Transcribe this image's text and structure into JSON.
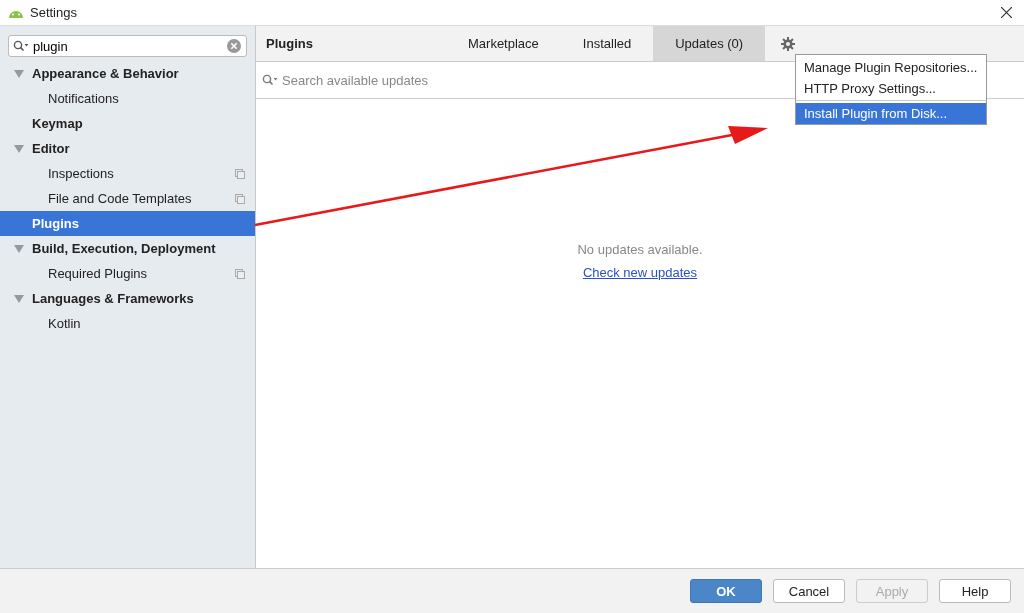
{
  "window": {
    "title": "Settings"
  },
  "search": {
    "value": "plugin"
  },
  "tree": [
    {
      "label": "Appearance & Behavior",
      "expanded": true,
      "selected": false,
      "children": [
        {
          "label": "Notifications",
          "selected": false,
          "project_scoped": false
        }
      ]
    },
    {
      "label": "Keymap",
      "selected": false
    },
    {
      "label": "Editor",
      "expanded": true,
      "selected": false,
      "children": [
        {
          "label": "Inspections",
          "selected": false,
          "project_scoped": true
        },
        {
          "label": "File and Code Templates",
          "selected": false,
          "project_scoped": true
        }
      ]
    },
    {
      "label": "Plugins",
      "selected": true
    },
    {
      "label": "Build, Execution, Deployment",
      "expanded": true,
      "selected": false,
      "children": [
        {
          "label": "Required Plugins",
          "selected": false,
          "project_scoped": true
        }
      ]
    },
    {
      "label": "Languages & Frameworks",
      "expanded": true,
      "selected": false,
      "children": [
        {
          "label": "Kotlin",
          "selected": false,
          "project_scoped": false
        }
      ]
    }
  ],
  "panel": {
    "title": "Plugins",
    "tabs": [
      {
        "label": "Marketplace",
        "selected": false
      },
      {
        "label": "Installed",
        "selected": false
      },
      {
        "label": "Updates (0)",
        "selected": true
      }
    ],
    "search_placeholder": "Search available updates",
    "empty_message": "No updates available.",
    "empty_link": "Check new updates"
  },
  "menu": [
    {
      "label": "Manage Plugin Repositories...",
      "selected": false,
      "separator_before": false
    },
    {
      "label": "HTTP Proxy Settings...",
      "selected": false,
      "separator_before": false
    },
    {
      "label": "Install Plugin from Disk...",
      "selected": true,
      "separator_before": true
    }
  ],
  "buttons": [
    {
      "label": "OK",
      "kind": "primary",
      "disabled": false
    },
    {
      "label": "Cancel",
      "kind": "normal",
      "disabled": false
    },
    {
      "label": "Apply",
      "kind": "normal",
      "disabled": true
    },
    {
      "label": "Help",
      "kind": "normal",
      "disabled": false
    }
  ]
}
